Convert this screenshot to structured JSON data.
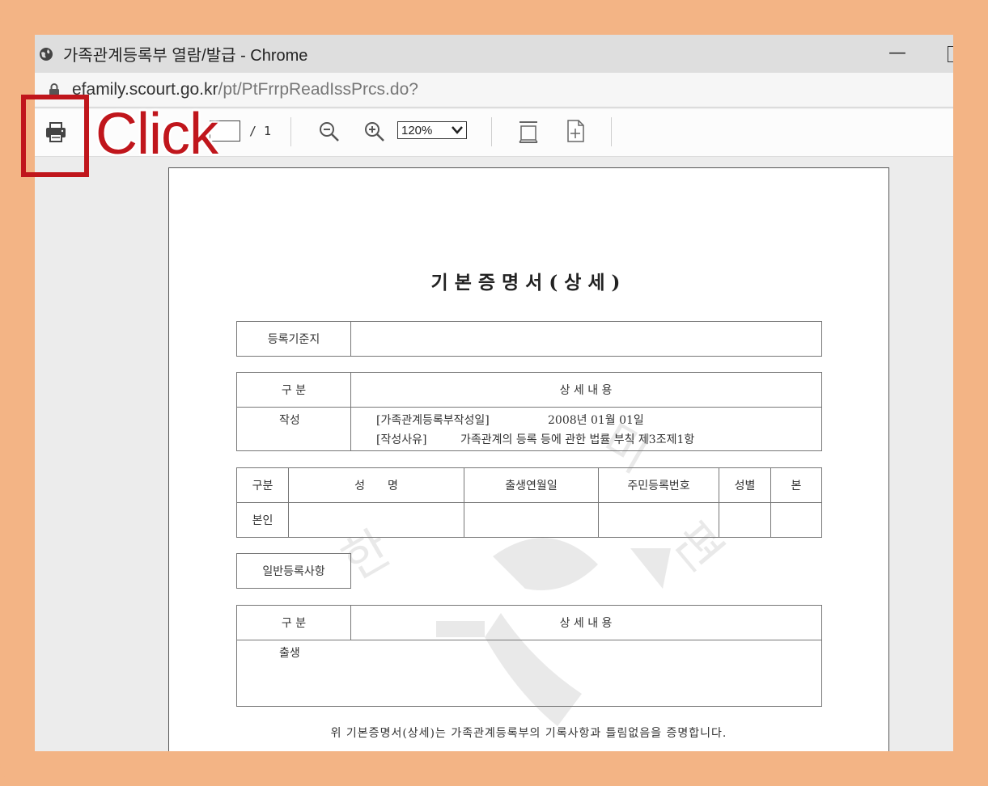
{
  "window": {
    "title": "가족관계등록부 열람/발급 - Chrome",
    "minimize_glyph": "—",
    "url_host": "efamily.scourt.go.kr",
    "url_path": "/pt/PtFrrpReadIssPrcs.do?"
  },
  "toolbar": {
    "page_total": "/ 1",
    "zoom_value": "120%",
    "icons": [
      "print-icon",
      "zoom-out-icon",
      "zoom-in-icon",
      "fit-page-icon",
      "rotate-icon"
    ]
  },
  "annotation": {
    "label": "Click",
    "color": "#c0161c"
  },
  "document": {
    "title": "기본증명서(상세)",
    "registration_label": "등록기준지",
    "registration_value": "",
    "section1": {
      "header_category": "구 분",
      "header_detail": "상 세 내 용",
      "row_label": "작성",
      "line1_label": "[가족관계등록부작성일]",
      "line1_value": "2008년 01월 01일",
      "line2_label": "[작성사유]",
      "line2_value": "가족관계의 등록 등에 관한 법률 부칙 제3조제1항"
    },
    "person_table": {
      "headers": [
        "구분",
        "성　　명",
        "출생연월일",
        "주민등록번호",
        "성별",
        "본"
      ],
      "row_label": "본인"
    },
    "general_label": "일반등록사항",
    "section2": {
      "header_category": "구 분",
      "header_detail": "상 세 내 용",
      "row_label": "출생"
    },
    "footer": "위 기본증명서(상세)는 가족관계등록부의 기록사항과 틀림없음을 증명합니다."
  }
}
